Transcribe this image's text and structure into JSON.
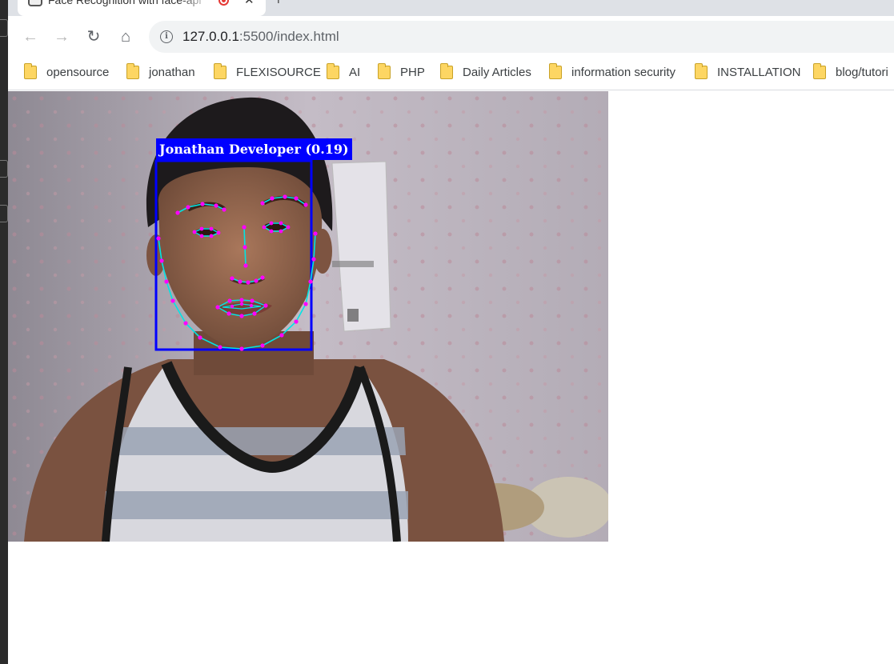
{
  "browser": {
    "tab": {
      "title": "Face Recognition with face-api",
      "favicon": "webcam-icon",
      "recording_indicator": "record-icon",
      "close_glyph": "✕"
    },
    "new_tab_glyph": "+",
    "nav": {
      "back_glyph": "←",
      "forward_glyph": "→",
      "reload_glyph": "↻",
      "home_glyph": "⌂"
    },
    "address": {
      "host": "127.0.0.1",
      "rest": ":5500/index.html",
      "security_icon": "info-icon"
    },
    "bookmarks": [
      {
        "label": "opensource"
      },
      {
        "label": "jonathan"
      },
      {
        "label": "FLEXISOURCE"
      },
      {
        "label": "AI"
      },
      {
        "label": "PHP"
      },
      {
        "label": "Daily Articles"
      },
      {
        "label": "information security"
      },
      {
        "label": "INSTALLATION"
      },
      {
        "label": "blog/tutori"
      }
    ]
  },
  "video": {
    "detection": {
      "label": "Jonathan Developer (0.19)",
      "box_color": "#0000ff",
      "landmark_color": "#ff00ff",
      "contour_color": "#00e5e5"
    }
  }
}
